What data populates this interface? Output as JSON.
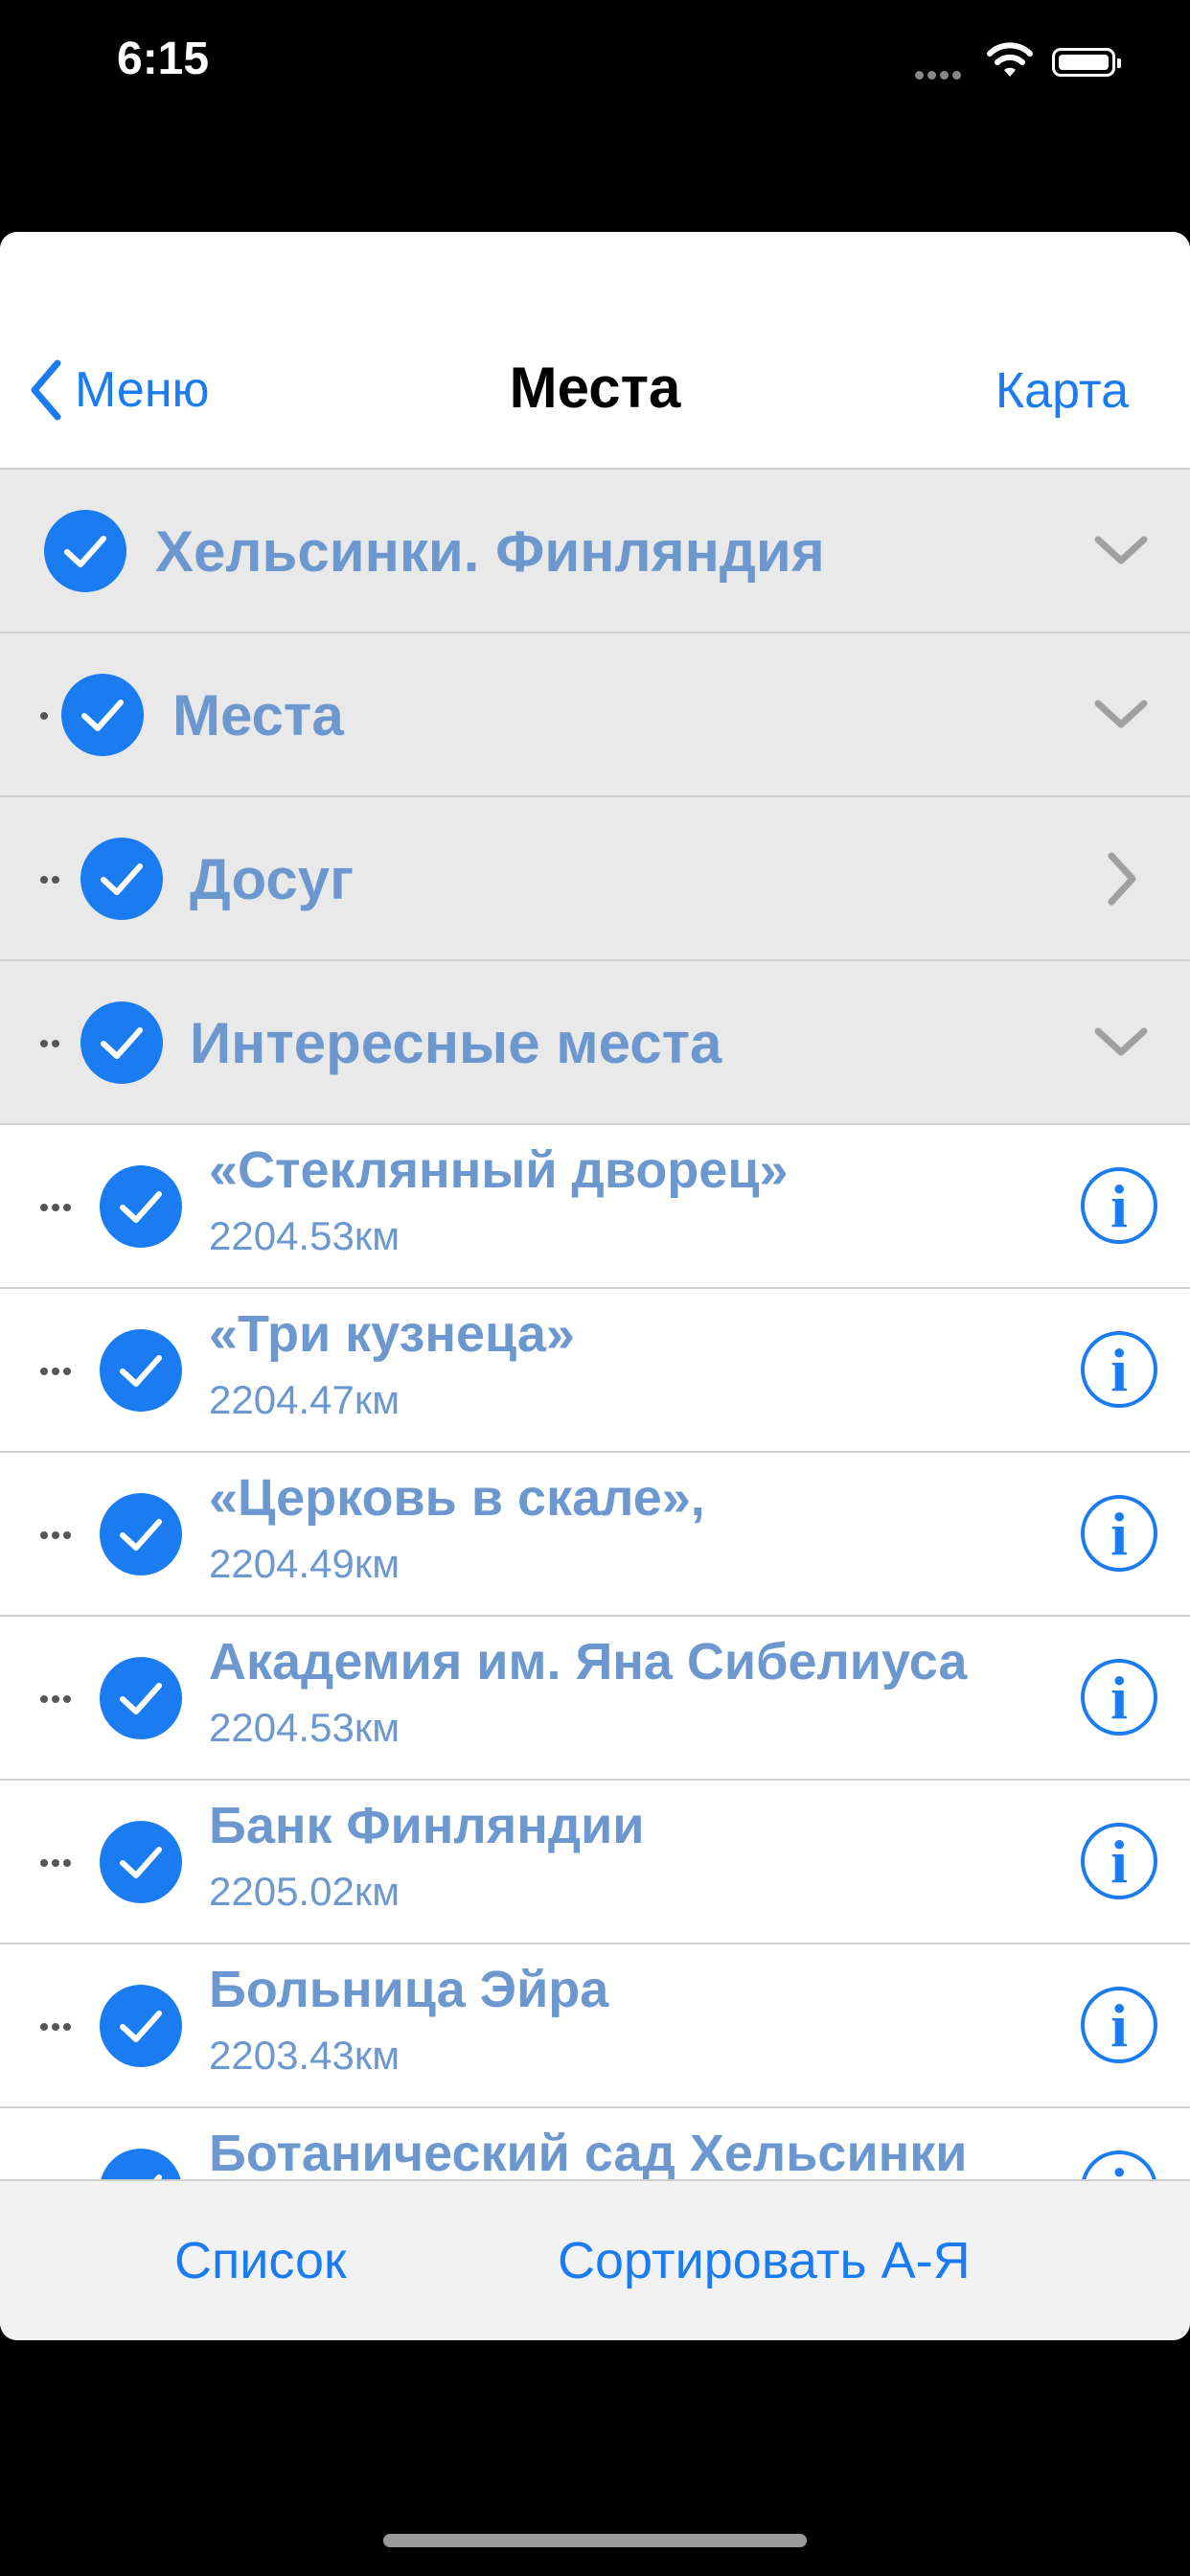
{
  "status_bar": {
    "time": "6:15"
  },
  "nav": {
    "back_label": "Меню",
    "title": "Места",
    "right_label": "Карта"
  },
  "groups": [
    {
      "label": "Хельсинки. Финляндия",
      "level": 0,
      "chevron": "chevron-down"
    },
    {
      "label": "Места",
      "level": 1,
      "chevron": "chevron-down"
    },
    {
      "label": "Досуг",
      "level": 2,
      "chevron": "chevron-right"
    },
    {
      "label": "Интересные места",
      "level": 2,
      "chevron": "chevron-down"
    }
  ],
  "places": [
    {
      "title": "«Стеклянный дворец»",
      "distance": "2204.53км"
    },
    {
      "title": "«Три кузнеца»",
      "distance": "2204.47км"
    },
    {
      "title": "«Церковь в скале»,",
      "distance": "2204.49км"
    },
    {
      "title": "Академия им. Яна Сибелиуса",
      "distance": "2204.53км"
    },
    {
      "title": "Банк Финляндии",
      "distance": "2205.02км"
    },
    {
      "title": "Больница Эйра",
      "distance": "2203.43км"
    },
    {
      "title": "Ботанический сад Хельсинки",
      "distance": ""
    }
  ],
  "info_glyph": "i",
  "toolbar": {
    "list_label": "Список",
    "sort_label": "Сортировать А-Я"
  },
  "colors": {
    "accent": "#1a7cf0",
    "item_text": "#6c98cf",
    "group_bg": "#e9e9e9"
  }
}
